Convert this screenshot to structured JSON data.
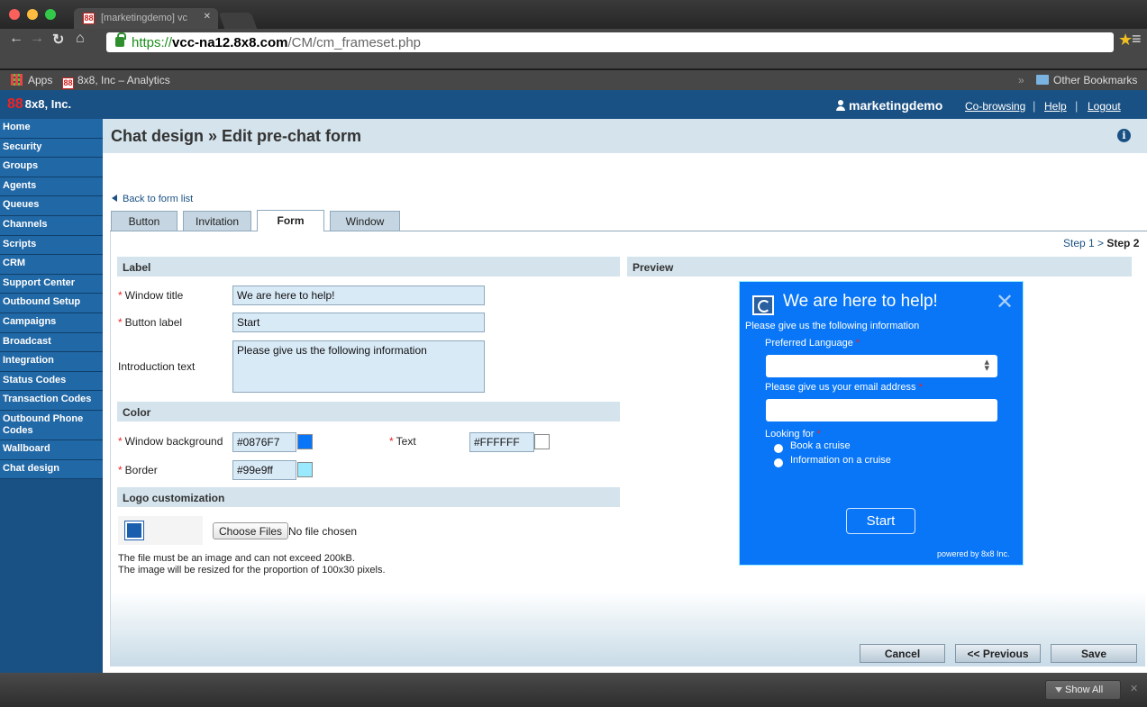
{
  "browser": {
    "tab_title": "[marketingdemo] vc",
    "tab_favicon": "88",
    "url_scheme": "https://",
    "url_host": "vcc-na12.8x8.com",
    "url_path": "/CM/cm_frameset.php",
    "bookmarks": [
      {
        "label": "Apps",
        "icon": "apps-grid-icon"
      },
      {
        "label": "8x8, Inc – Analytics",
        "icon": "8x8-favicon"
      }
    ],
    "other_bookmarks": "Other Bookmarks",
    "overflow": "»",
    "show_all": "Show All",
    "shelf_close": "✕"
  },
  "header": {
    "logo_text": "8x8, Inc.",
    "logo_mark": "88",
    "username": "marketingdemo",
    "links": [
      "Co-browsing",
      "Help",
      "Logout"
    ]
  },
  "sidebar": {
    "items": [
      "Home",
      "Security",
      "Groups",
      "Agents",
      "Queues",
      "Channels",
      "Scripts",
      "CRM",
      "Support Center",
      "Outbound Setup",
      "Campaigns",
      "Broadcast",
      "Integration",
      "Status Codes",
      "Transaction Codes",
      "Outbound Phone Codes",
      "Wallboard",
      "Chat design"
    ]
  },
  "page": {
    "title": "Chat design » Edit pre-chat form",
    "back_link": "Back to form list",
    "tabs": [
      "Button",
      "Invitation",
      "Form",
      "Window"
    ],
    "active_tab": "Form",
    "step_prefix": "Step 1 > ",
    "step_current": "Step 2"
  },
  "form": {
    "label_section": "Label",
    "window_title_label": "Window title",
    "window_title_value": "We are here to help!",
    "button_label_label": "Button label",
    "button_label_value": "Start",
    "intro_label": "Introduction text",
    "intro_value": "Please give us the following information",
    "color_section": "Color",
    "window_bg_label": "Window background",
    "window_bg_value": "#0876F7",
    "text_color_label": "Text",
    "text_color_value": "#FFFFFF",
    "border_label": "Border",
    "border_value": "#99e9ff",
    "logo_section": "Logo customization",
    "choose_files": "Choose Files",
    "no_file": "No file chosen",
    "note_1": "The file must be an image and can not exceed 200kB.",
    "note_2": "The image will be resized for the proportion of 100x30 pixels.",
    "required_mark": "*"
  },
  "preview": {
    "section": "Preview",
    "title": "We are here to help!",
    "close": "✕",
    "intro": "Please give us the following information",
    "language_label": "Preferred Language",
    "email_label": "Please give us your email address",
    "looking_for_label": "Looking for",
    "options": [
      "Book a cruise",
      "Information on a cruise"
    ],
    "start_button": "Start",
    "powered_by": "powered by 8x8 Inc."
  },
  "footer": {
    "cancel": "Cancel",
    "previous": "<< Previous",
    "save": "Save"
  },
  "colors": {
    "header_blue": "#1a5184",
    "sidebar_item": "#2168a6",
    "section_bg": "#d4e3ec",
    "input_bg": "#d9eaf7",
    "preview_bg": "#0876F7",
    "preview_border": "#99e9ff",
    "required": "#e22222"
  }
}
